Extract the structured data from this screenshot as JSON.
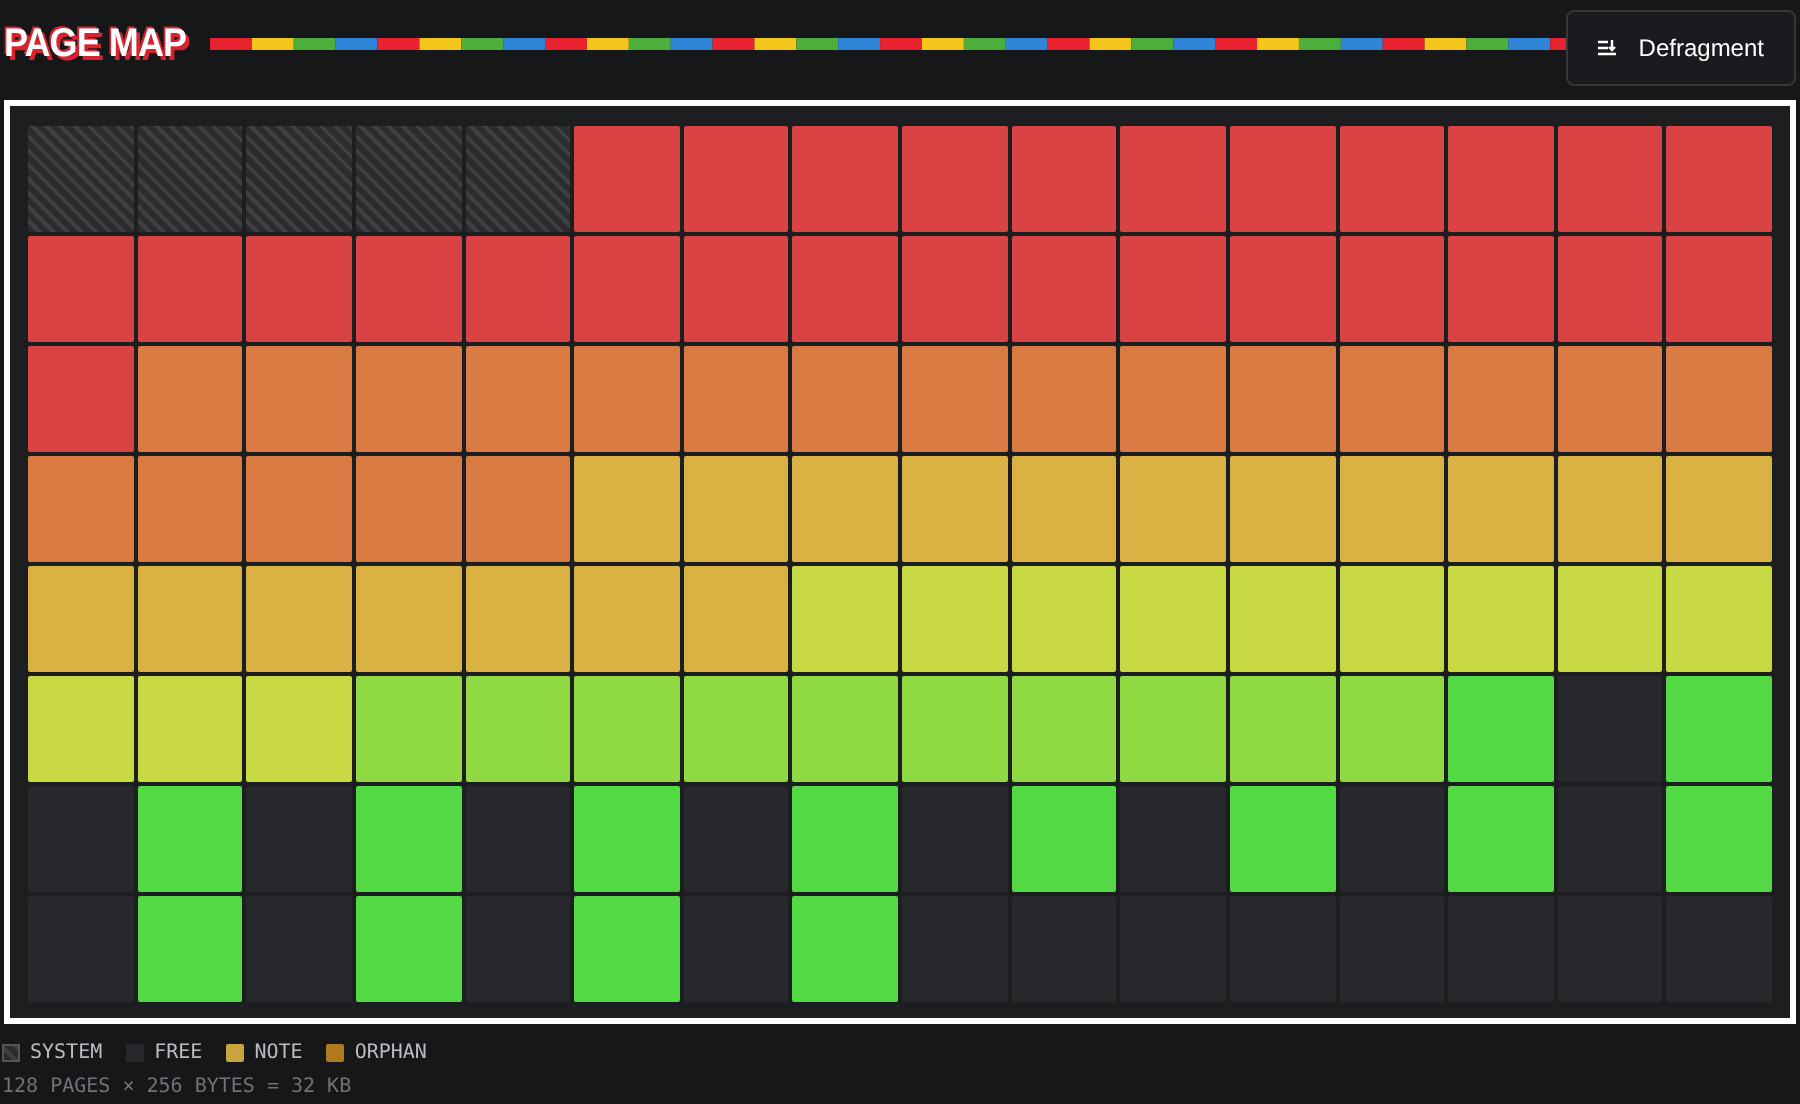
{
  "title": "PAGE MAP",
  "defragment_button": {
    "label": "Defragment"
  },
  "grid": {
    "rows": [
      [
        {
          "kind": "system"
        },
        {
          "kind": "system"
        },
        {
          "kind": "system"
        },
        {
          "kind": "system"
        },
        {
          "kind": "system"
        },
        {
          "kind": "used",
          "color": "#d94343"
        },
        {
          "kind": "used",
          "color": "#d94343"
        },
        {
          "kind": "used",
          "color": "#d94343"
        },
        {
          "kind": "used",
          "color": "#d94343"
        },
        {
          "kind": "used",
          "color": "#d94343"
        },
        {
          "kind": "used",
          "color": "#d94343"
        },
        {
          "kind": "used",
          "color": "#d94343"
        },
        {
          "kind": "used",
          "color": "#d94343"
        },
        {
          "kind": "used",
          "color": "#d94343"
        },
        {
          "kind": "used",
          "color": "#d94343"
        },
        {
          "kind": "used",
          "color": "#d94343"
        }
      ],
      [
        {
          "kind": "used",
          "color": "#d94343"
        },
        {
          "kind": "used",
          "color": "#d94343"
        },
        {
          "kind": "used",
          "color": "#d94343"
        },
        {
          "kind": "used",
          "color": "#d94343"
        },
        {
          "kind": "used",
          "color": "#d94343"
        },
        {
          "kind": "used",
          "color": "#d94343"
        },
        {
          "kind": "used",
          "color": "#d94343"
        },
        {
          "kind": "used",
          "color": "#d94343"
        },
        {
          "kind": "used",
          "color": "#d94343"
        },
        {
          "kind": "used",
          "color": "#d94343"
        },
        {
          "kind": "used",
          "color": "#d94343"
        },
        {
          "kind": "used",
          "color": "#d94343"
        },
        {
          "kind": "used",
          "color": "#d94343"
        },
        {
          "kind": "used",
          "color": "#d94343"
        },
        {
          "kind": "used",
          "color": "#d94343"
        },
        {
          "kind": "used",
          "color": "#d94343"
        }
      ],
      [
        {
          "kind": "used",
          "color": "#d94343"
        },
        {
          "kind": "used",
          "color": "#d97b43"
        },
        {
          "kind": "used",
          "color": "#d97b43"
        },
        {
          "kind": "used",
          "color": "#d97b43"
        },
        {
          "kind": "used",
          "color": "#d97b43"
        },
        {
          "kind": "used",
          "color": "#d97b43"
        },
        {
          "kind": "used",
          "color": "#d97b43"
        },
        {
          "kind": "used",
          "color": "#d97b43"
        },
        {
          "kind": "used",
          "color": "#d97b43"
        },
        {
          "kind": "used",
          "color": "#d97b43"
        },
        {
          "kind": "used",
          "color": "#d97b43"
        },
        {
          "kind": "used",
          "color": "#d97b43"
        },
        {
          "kind": "used",
          "color": "#d97b43"
        },
        {
          "kind": "used",
          "color": "#d97b43"
        },
        {
          "kind": "used",
          "color": "#d97b43"
        },
        {
          "kind": "used",
          "color": "#d97b43"
        }
      ],
      [
        {
          "kind": "used",
          "color": "#d97b43"
        },
        {
          "kind": "used",
          "color": "#d97b43"
        },
        {
          "kind": "used",
          "color": "#d97b43"
        },
        {
          "kind": "used",
          "color": "#d97b43"
        },
        {
          "kind": "used",
          "color": "#d97b43"
        },
        {
          "kind": "used",
          "color": "#d9b243"
        },
        {
          "kind": "used",
          "color": "#d9b243"
        },
        {
          "kind": "used",
          "color": "#d9b243"
        },
        {
          "kind": "used",
          "color": "#d9b243"
        },
        {
          "kind": "used",
          "color": "#d9b243"
        },
        {
          "kind": "used",
          "color": "#d9b243"
        },
        {
          "kind": "used",
          "color": "#d9b243"
        },
        {
          "kind": "used",
          "color": "#d9b243"
        },
        {
          "kind": "used",
          "color": "#d9b243"
        },
        {
          "kind": "used",
          "color": "#d9b243"
        },
        {
          "kind": "used",
          "color": "#d9b243"
        }
      ],
      [
        {
          "kind": "used",
          "color": "#d9b243"
        },
        {
          "kind": "used",
          "color": "#d9b243"
        },
        {
          "kind": "used",
          "color": "#d9b243"
        },
        {
          "kind": "used",
          "color": "#d9b243"
        },
        {
          "kind": "used",
          "color": "#d9b243"
        },
        {
          "kind": "used",
          "color": "#d9b243"
        },
        {
          "kind": "used",
          "color": "#d9b243"
        },
        {
          "kind": "used",
          "color": "#c8d943"
        },
        {
          "kind": "used",
          "color": "#c8d943"
        },
        {
          "kind": "used",
          "color": "#c8d943"
        },
        {
          "kind": "used",
          "color": "#c8d943"
        },
        {
          "kind": "used",
          "color": "#c8d943"
        },
        {
          "kind": "used",
          "color": "#c8d943"
        },
        {
          "kind": "used",
          "color": "#c8d943"
        },
        {
          "kind": "used",
          "color": "#c8d943"
        },
        {
          "kind": "used",
          "color": "#c8d943"
        }
      ],
      [
        {
          "kind": "used",
          "color": "#c8d943"
        },
        {
          "kind": "used",
          "color": "#c8d943"
        },
        {
          "kind": "used",
          "color": "#c8d943"
        },
        {
          "kind": "used",
          "color": "#8fd943"
        },
        {
          "kind": "used",
          "color": "#8fd943"
        },
        {
          "kind": "used",
          "color": "#8fd943"
        },
        {
          "kind": "used",
          "color": "#8fd943"
        },
        {
          "kind": "used",
          "color": "#8fd943"
        },
        {
          "kind": "used",
          "color": "#8fd943"
        },
        {
          "kind": "used",
          "color": "#8fd943"
        },
        {
          "kind": "used",
          "color": "#8fd943"
        },
        {
          "kind": "used",
          "color": "#8fd943"
        },
        {
          "kind": "used",
          "color": "#8fd943"
        },
        {
          "kind": "used",
          "color": "#52d943"
        },
        {
          "kind": "free"
        },
        {
          "kind": "used",
          "color": "#52d943"
        }
      ],
      [
        {
          "kind": "free"
        },
        {
          "kind": "used",
          "color": "#52d943"
        },
        {
          "kind": "free"
        },
        {
          "kind": "used",
          "color": "#52d943"
        },
        {
          "kind": "free"
        },
        {
          "kind": "used",
          "color": "#52d943"
        },
        {
          "kind": "free"
        },
        {
          "kind": "used",
          "color": "#52d943"
        },
        {
          "kind": "free"
        },
        {
          "kind": "used",
          "color": "#52d943"
        },
        {
          "kind": "free"
        },
        {
          "kind": "used",
          "color": "#52d943"
        },
        {
          "kind": "free"
        },
        {
          "kind": "used",
          "color": "#52d943"
        },
        {
          "kind": "free"
        },
        {
          "kind": "used",
          "color": "#52d943"
        }
      ],
      [
        {
          "kind": "free"
        },
        {
          "kind": "used",
          "color": "#52d943"
        },
        {
          "kind": "free"
        },
        {
          "kind": "used",
          "color": "#52d943"
        },
        {
          "kind": "free"
        },
        {
          "kind": "used",
          "color": "#52d943"
        },
        {
          "kind": "free"
        },
        {
          "kind": "used",
          "color": "#52d943"
        },
        {
          "kind": "free"
        },
        {
          "kind": "free"
        },
        {
          "kind": "free"
        },
        {
          "kind": "free"
        },
        {
          "kind": "free"
        },
        {
          "kind": "free"
        },
        {
          "kind": "free"
        },
        {
          "kind": "free"
        }
      ]
    ]
  },
  "legend": [
    {
      "kind": "system",
      "label": "SYSTEM"
    },
    {
      "kind": "free",
      "label": "FREE"
    },
    {
      "kind": "swatch",
      "label": "NOTE",
      "color": "#c9a43f"
    },
    {
      "kind": "swatch",
      "label": "ORPHAN",
      "color": "#b07a1f"
    }
  ],
  "footer": "128 PAGES × 256 BYTES = 32 KB"
}
